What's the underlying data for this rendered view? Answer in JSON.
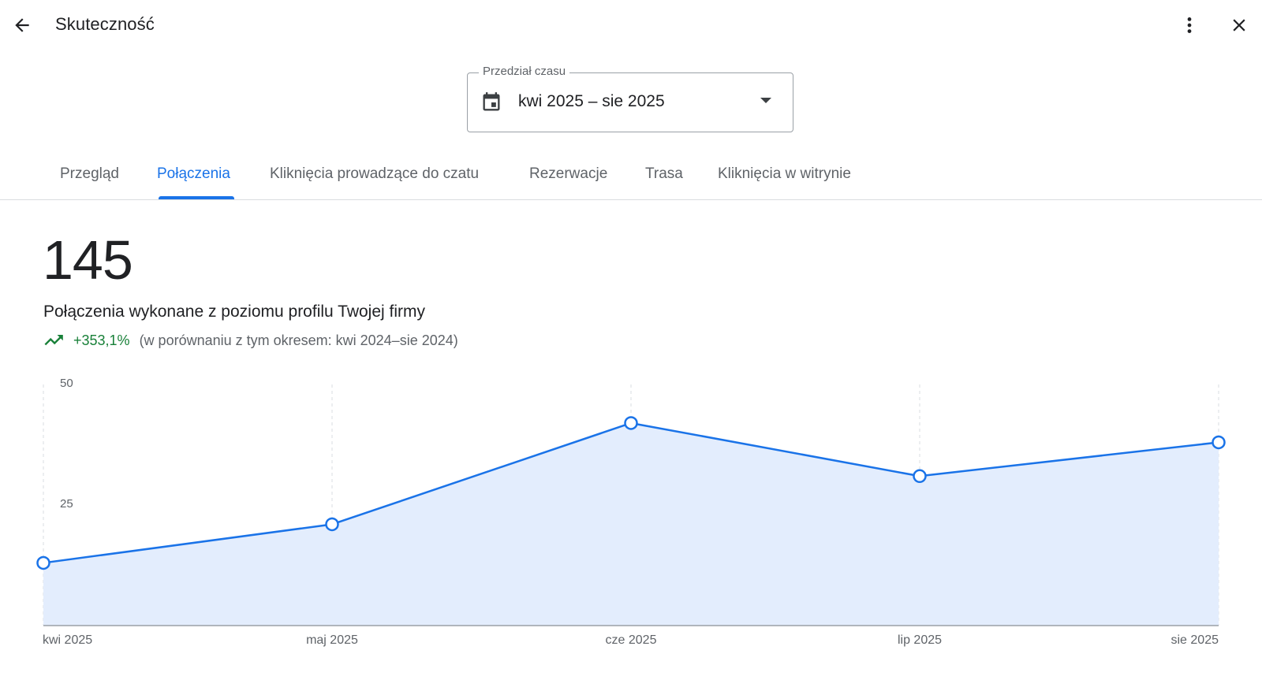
{
  "header": {
    "title": "Skuteczność",
    "back_icon": "arrow-back-icon",
    "more_icon": "more-vert-icon",
    "close_icon": "close-icon"
  },
  "date_range": {
    "label": "Przedział czasu",
    "value": "kwi 2025 – sie 2025",
    "icon": "calendar-icon"
  },
  "tabs": [
    {
      "label": "Przegląd",
      "active": false
    },
    {
      "label": "Połączenia",
      "active": true
    },
    {
      "label": "Kliknięcia prowadzące do czatu",
      "active": false
    },
    {
      "label": "Rezerwacje",
      "active": false
    },
    {
      "label": "Trasa",
      "active": false
    },
    {
      "label": "Kliknięcia w witrynie",
      "active": false
    }
  ],
  "summary": {
    "total": "145",
    "description": "Połączenia wykonane z poziomu profilu Twojej firmy",
    "change": "+353,1%",
    "comparison": "(w porównaniu z tym okresem: kwi 2024–sie 2024)",
    "trend_icon": "trending-up-icon"
  },
  "colors": {
    "accent": "#1a73e8",
    "positive": "#188038",
    "area_fill": "#e3edfd"
  },
  "chart_data": {
    "type": "area",
    "categories": [
      "kwi 2025",
      "maj 2025",
      "cze 2025",
      "lip 2025",
      "sie 2025"
    ],
    "values": [
      13,
      21,
      42,
      31,
      38
    ],
    "yticks": [
      "25",
      "50"
    ],
    "ylim": [
      0,
      50
    ],
    "grid": "vertical dashed",
    "title": "",
    "xlabel": "",
    "ylabel": ""
  }
}
